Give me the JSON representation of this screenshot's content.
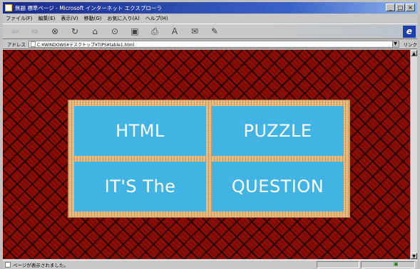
{
  "window": {
    "title": "無題 標準ページ - Microsoft インターネット エクスプローラ"
  },
  "menu": {
    "items": [
      "ファイル(F)",
      "編集(E)",
      "表示(V)",
      "移動(G)",
      "お気に入り(A)",
      "ヘルプ(H)"
    ]
  },
  "toolbar": {
    "buttons": [
      {
        "name": "back-icon",
        "glyph": "⇦"
      },
      {
        "name": "forward-icon",
        "glyph": "⇨"
      },
      {
        "name": "stop-icon",
        "glyph": "⊗"
      },
      {
        "name": "refresh-icon",
        "glyph": "↻"
      },
      {
        "name": "home-icon",
        "glyph": "⌂"
      },
      {
        "name": "search-icon",
        "glyph": "⊙"
      },
      {
        "name": "favorites-icon",
        "glyph": "▣"
      },
      {
        "name": "print-icon",
        "glyph": "⎙"
      },
      {
        "name": "font-icon",
        "glyph": "A"
      },
      {
        "name": "mail-icon",
        "glyph": "✉"
      },
      {
        "name": "edit-icon",
        "glyph": "✎"
      }
    ],
    "brand_glyph": "e"
  },
  "address": {
    "label": "アドレス",
    "value": "C:¥WINDOWS¥デスクトップ¥TIPS¥table1.html",
    "links_label": "リンク"
  },
  "page": {
    "cells": [
      "HTML",
      "PUZZLE",
      "IT'S The",
      "QUESTION"
    ],
    "colors": {
      "cell_bg": "#41b4e3",
      "cell_text": "#ffffff",
      "frame": "#e3b77a",
      "background": "#7e0a04"
    }
  },
  "status": {
    "text": "ページが表示されました。"
  }
}
